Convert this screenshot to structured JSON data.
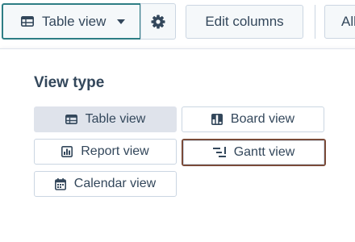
{
  "toolbar": {
    "view_selector": {
      "label": "Table view",
      "icon": "table-icon",
      "caret_icon": "caret-down-icon"
    },
    "settings_icon": "gear-icon",
    "edit_columns_label": "Edit columns",
    "all_label": "All",
    "colors": {
      "selected_border": "#2d7d84",
      "button_bg": "#f5f8fa",
      "border": "#cbd6e2",
      "text": "#33475b"
    }
  },
  "popover": {
    "title": "View type",
    "options": [
      {
        "label": "Table view",
        "icon": "table-icon",
        "selected": true
      },
      {
        "label": "Board view",
        "icon": "board-icon",
        "selected": false
      },
      {
        "label": "Report view",
        "icon": "report-icon",
        "selected": false
      },
      {
        "label": "Gantt view",
        "icon": "gantt-icon",
        "selected": false,
        "highlighted": true
      },
      {
        "label": "Calendar view",
        "icon": "calendar-icon",
        "selected": false
      }
    ],
    "colors": {
      "selected_bg": "#dfe3eb",
      "highlight_border": "#7a4a38"
    }
  }
}
